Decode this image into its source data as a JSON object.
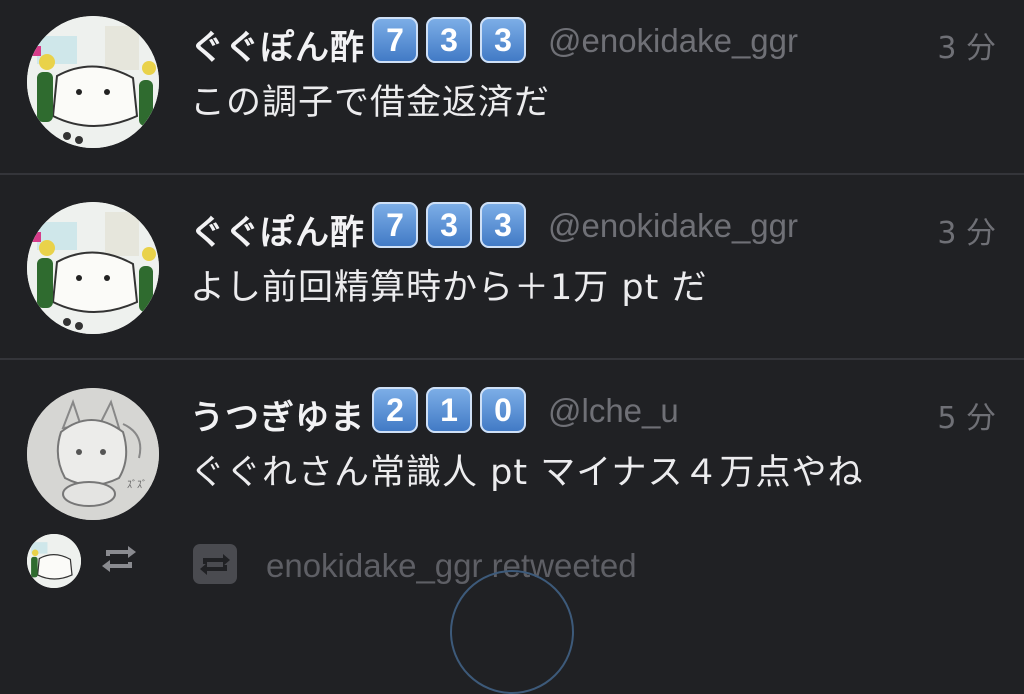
{
  "tweets": [
    {
      "name": "ぐぐぽん酢",
      "badges": [
        "7",
        "3",
        "3"
      ],
      "handle": "@enokidake_ggr",
      "time": "3 分",
      "text": "この調子で借金返済だ",
      "avatar_icon": "cat-bottle-avatar"
    },
    {
      "name": "ぐぐぽん酢",
      "badges": [
        "7",
        "3",
        "3"
      ],
      "handle": "@enokidake_ggr",
      "time": "3 分",
      "text": "よし前回精算時から＋1万 pt だ",
      "avatar_icon": "cat-bottle-avatar"
    },
    {
      "name": "うつぎゆま",
      "badges": [
        "2",
        "1",
        "0"
      ],
      "handle": "@lche_u",
      "time": "5 分",
      "text": "ぐぐれさん常識人 pt マイナス４万点やね",
      "avatar_icon": "sketch-girl-avatar"
    }
  ],
  "retweet_row": {
    "label": "enokidake_ggr retweeted",
    "icon": "retweet-icon"
  },
  "colors": {
    "background": "#202124",
    "divider": "#34353a",
    "muted_text": "#6f7076",
    "badge": "#5b8fd4"
  }
}
